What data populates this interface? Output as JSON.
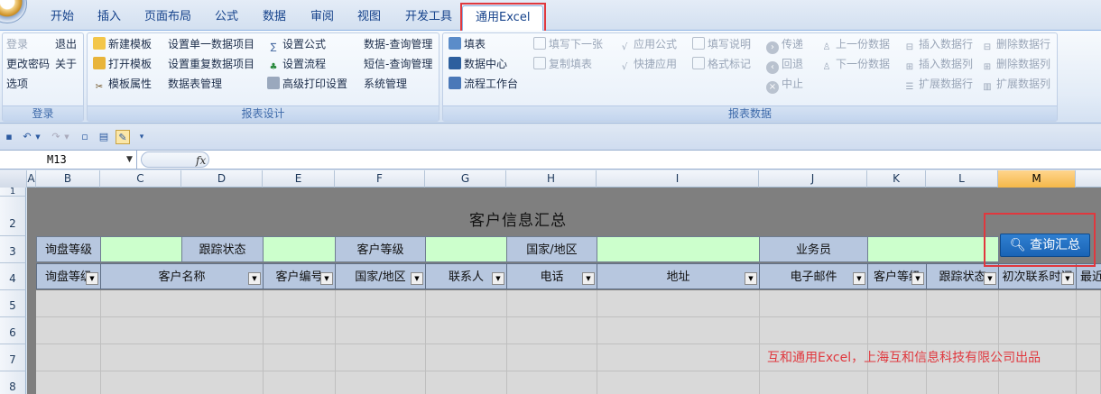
{
  "tabs": [
    "开始",
    "插入",
    "页面布局",
    "公式",
    "数据",
    "审阅",
    "视图",
    "开发工具",
    "通用Excel"
  ],
  "ribbon": {
    "login_group": {
      "label": "登录",
      "items": [
        "登录",
        "退出",
        "更改密码",
        "关于",
        "选项"
      ]
    },
    "design_group": {
      "label": "报表设计",
      "items": [
        "新建模板",
        "打开模板",
        "模板属性",
        "设置单一数据项目",
        "设置重复数据项目",
        "数据表管理",
        "设置公式",
        "设置流程",
        "高级打印设置",
        "数据-查询管理",
        "短信-查询管理",
        "系统管理"
      ]
    },
    "data_group": {
      "label": "报表数据",
      "items": [
        "填表",
        "数据中心",
        "流程工作台",
        "填写下一张",
        "复制填表",
        "应用公式",
        "快捷应用",
        "填写说明",
        "格式标记",
        "传递",
        "回退",
        "中止",
        "上一份数据",
        "下一份数据",
        "插入数据行",
        "插入数据列",
        "扩展数据行",
        "删除数据行",
        "删除数据列",
        "扩展数据列"
      ]
    }
  },
  "namebox": "M13",
  "fx_label": "fx",
  "columns": [
    "A",
    "B",
    "C",
    "D",
    "E",
    "F",
    "G",
    "H",
    "I",
    "J",
    "K",
    "L",
    "M"
  ],
  "rows": [
    "1",
    "2",
    "3",
    "4",
    "5",
    "6",
    "7",
    "8"
  ],
  "sheet": {
    "title": "客户信息汇总",
    "filters": [
      "询盘等级",
      "跟踪状态",
      "客户等级",
      "国家/地区",
      "业务员"
    ],
    "query_button": "查询汇总",
    "headers": [
      "询盘等级",
      "客户名称",
      "客户编号",
      "国家/地区",
      "联系人",
      "电话",
      "地址",
      "电子邮件",
      "客户等级",
      "跟踪状态",
      "初次联系时间",
      "最近"
    ],
    "footer": "互和通用Excel，上海互和信息科技有限公司出品"
  },
  "colors": {
    "accent_red": "#e0383e",
    "input_green": "#ccffcc",
    "header_blue": "#b7c7df",
    "button_blue": "#1a64b6"
  }
}
